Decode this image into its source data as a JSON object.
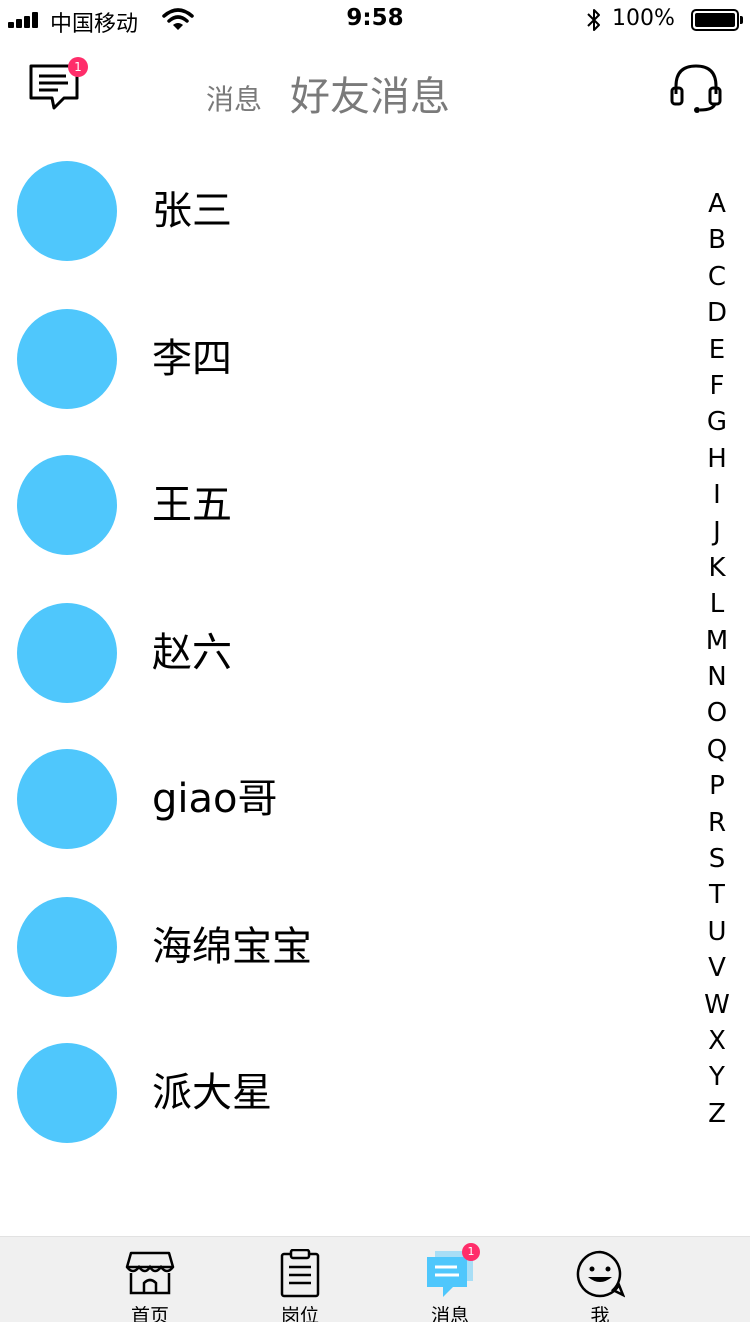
{
  "status_bar": {
    "carrier": "中国移动",
    "time": "9:58",
    "battery": "100%"
  },
  "header": {
    "message_badge": "1",
    "tab_messages": "消息",
    "tab_friend_messages": "好友消息"
  },
  "contacts": [
    {
      "name": "张三"
    },
    {
      "name": "李四"
    },
    {
      "name": "王五"
    },
    {
      "name": "赵六"
    },
    {
      "name": "giao哥"
    },
    {
      "name": "海绵宝宝"
    },
    {
      "name": "派大星"
    }
  ],
  "alphabet_index": [
    "A",
    "B",
    "C",
    "D",
    "E",
    "F",
    "G",
    "H",
    "I",
    "J",
    "K",
    "L",
    "M",
    "N",
    "O",
    "Q",
    "P",
    "R",
    "S",
    "T",
    "U",
    "V",
    "W",
    "X",
    "Y",
    "Z"
  ],
  "tab_bar": {
    "items": [
      {
        "label": "首页",
        "icon": "store-icon"
      },
      {
        "label": "岗位",
        "icon": "clipboard-icon"
      },
      {
        "label": "消息",
        "icon": "chat-icon",
        "badge": "1"
      },
      {
        "label": "我",
        "icon": "smiley-icon"
      }
    ],
    "active_color": "#4fc7fc"
  },
  "colors": {
    "avatar": "#4fc7fc",
    "badge": "#ff2d6a"
  }
}
